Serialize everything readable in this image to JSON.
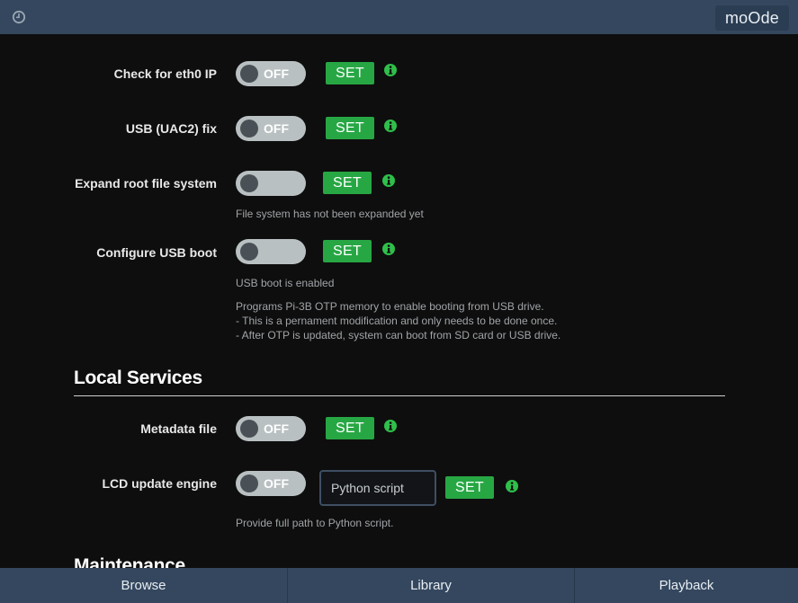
{
  "topbar": {
    "brand": "moOde",
    "clock_icon": "clock-icon"
  },
  "settings": {
    "eth0": {
      "label": "Check for eth0 IP",
      "toggle": "OFF",
      "set": "SET"
    },
    "uac2": {
      "label": "USB (UAC2) fix",
      "toggle": "OFF",
      "set": "SET"
    },
    "expand": {
      "label": "Expand root file system",
      "toggle": "",
      "set": "SET",
      "help": "File system has not been expanded yet"
    },
    "usbboot": {
      "label": "Configure USB boot",
      "toggle": "",
      "set": "SET",
      "status": "USB boot is enabled",
      "help_lines": [
        "Programs Pi-3B OTP memory to enable booting from USB drive.",
        "- This is a pernament modification and only needs to be done once.",
        "- After OTP is updated, system can boot from SD card or USB drive."
      ]
    }
  },
  "local_services": {
    "title": "Local Services",
    "metadata": {
      "label": "Metadata file",
      "toggle": "OFF",
      "set": "SET"
    },
    "lcd": {
      "label": "LCD update engine",
      "toggle": "OFF",
      "input_value": "Python script",
      "set": "SET",
      "help": "Provide full path to Python script."
    }
  },
  "maintenance": {
    "title": "Maintenance"
  },
  "bottom_tabs": [
    "Browse",
    "Library",
    "Playback"
  ],
  "colors": {
    "accent_green": "#27a744",
    "bar": "#34475e",
    "info_green": "#2fbf4a"
  }
}
